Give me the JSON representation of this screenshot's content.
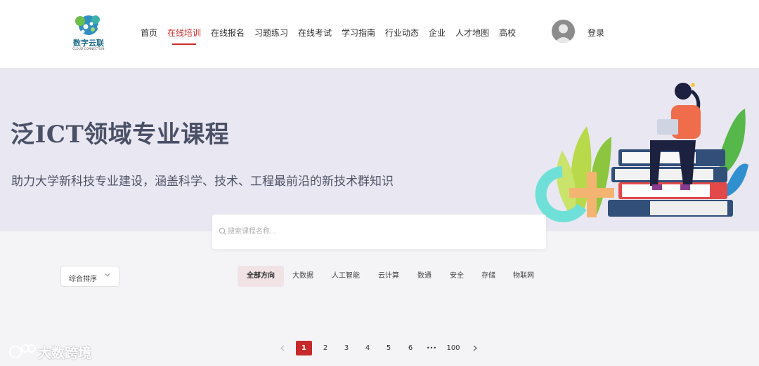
{
  "header": {
    "logo_text": "数字云联",
    "logo_subtext": "CLOUD CONNECTION",
    "nav": [
      {
        "label": "首页",
        "active": false
      },
      {
        "label": "在线培训",
        "active": true
      },
      {
        "label": "在线报名",
        "active": false
      },
      {
        "label": "习题练习",
        "active": false
      },
      {
        "label": "在线考试",
        "active": false
      },
      {
        "label": "学习指南",
        "active": false
      },
      {
        "label": "行业动态",
        "active": false
      },
      {
        "label": "企业",
        "active": false
      },
      {
        "label": "人才地图",
        "active": false
      },
      {
        "label": "高校",
        "active": false
      }
    ],
    "login_label": "登录",
    "accent_color": "#c62a2a"
  },
  "banner": {
    "title": "泛ICT领域专业课程",
    "subtitle": "助力大学新科技专业建设，涵盖科学、技术、工程最前沿的新技术群知识",
    "background": "#e9e7f1"
  },
  "search": {
    "placeholder": "搜索课程名称...",
    "value": ""
  },
  "sort": {
    "selected": "综合排序"
  },
  "filters": [
    {
      "label": "全部方向",
      "active": true
    },
    {
      "label": "大数据",
      "active": false
    },
    {
      "label": "人工智能",
      "active": false
    },
    {
      "label": "云计算",
      "active": false
    },
    {
      "label": "数通",
      "active": false
    },
    {
      "label": "安全",
      "active": false
    },
    {
      "label": "存储",
      "active": false
    },
    {
      "label": "物联网",
      "active": false
    }
  ],
  "pagination": {
    "current": "1",
    "pages": [
      "1",
      "2",
      "3",
      "4",
      "5",
      "6",
      "•••",
      "100"
    ]
  },
  "watermark": {
    "text": "大数跨境"
  }
}
